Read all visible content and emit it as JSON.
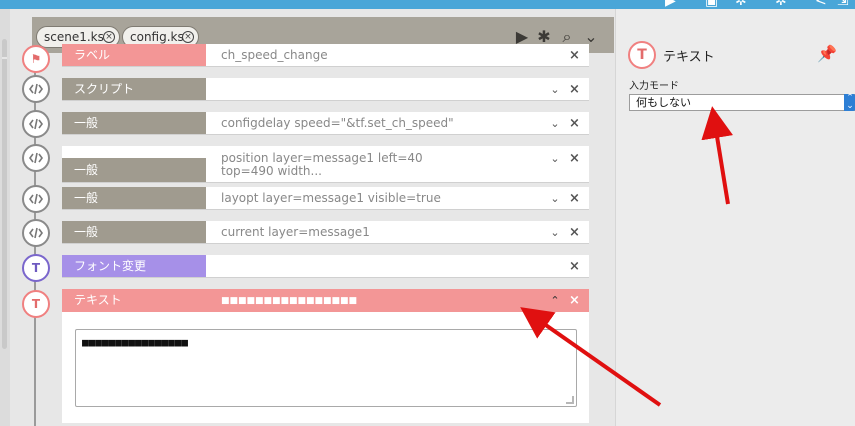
{
  "tabs": [
    {
      "label": "scene1.ks"
    },
    {
      "label": "config.ks"
    }
  ],
  "toolbar": {
    "run_icon": "play-icon",
    "debug_icon": "bug-icon",
    "search_icon": "search-icon",
    "menu_icon": "chevron-down-icon"
  },
  "rows": [
    {
      "label": "ラベル",
      "content": "ch_speed_change",
      "type": "label"
    },
    {
      "label": "スクリプト",
      "content": "",
      "type": "script"
    },
    {
      "label": "一般",
      "content": "configdelay speed=\"&tf.set_ch_speed\"",
      "type": "general"
    },
    {
      "label": "一般",
      "content_line1": "position layer=message1 left=40",
      "content_line2": "top=490 width...",
      "type": "general"
    },
    {
      "label": "一般",
      "content": "layopt layer=message1 visible=true",
      "type": "general"
    },
    {
      "label": "一般",
      "content": "current layer=message1",
      "type": "general"
    },
    {
      "label": "フォント変更",
      "content": "",
      "type": "font"
    },
    {
      "label": "テキスト",
      "content": "■■■■■■■■■■■■■■■■",
      "type": "text"
    }
  ],
  "text_area_value": "■■■■■■■■■■■■■■■■",
  "inspector": {
    "title": "テキスト",
    "field_label": "入力モード",
    "select_value": "何もしない"
  },
  "colors": {
    "accent": "#4aa6d8",
    "label_gray": "#a09b8f",
    "label_red": "#f39696",
    "label_purple": "#a690e8",
    "annotation": "#e01010"
  }
}
